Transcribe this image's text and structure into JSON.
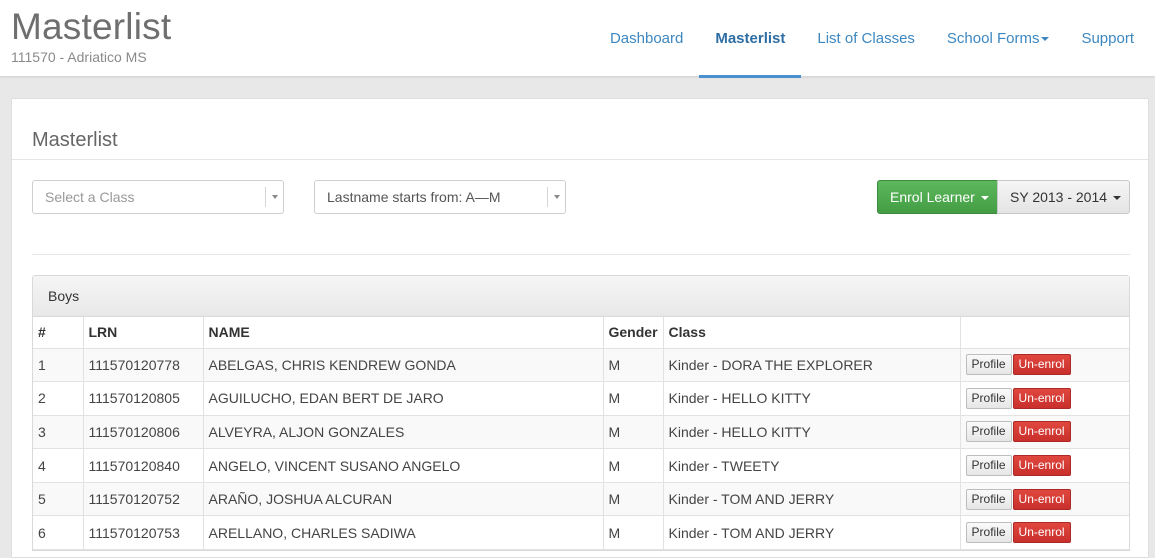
{
  "header": {
    "title": "Masterlist",
    "subtitle": "111570 - Adriatico MS"
  },
  "nav": {
    "items": [
      {
        "label": "Dashboard"
      },
      {
        "label": "Masterlist"
      },
      {
        "label": "List of Classes"
      },
      {
        "label": "School Forms"
      },
      {
        "label": "Support"
      }
    ]
  },
  "panel": {
    "title": "Masterlist"
  },
  "filters": {
    "class_placeholder": "Select a Class",
    "lastname_value": "Lastname starts from: A—M"
  },
  "actions": {
    "enrol_label": "Enrol Learner",
    "school_year_label": "SY 2013 - 2014"
  },
  "group": {
    "title": "Boys",
    "columns": [
      "#",
      "LRN",
      "NAME",
      "Gender",
      "Class",
      ""
    ],
    "profile_label": "Profile",
    "unenrol_label": "Un-enrol",
    "rows": [
      {
        "num": "1",
        "lrn": "111570120778",
        "name": "ABELGAS, CHRIS KENDREW GONDA",
        "gender": "M",
        "class": "Kinder - DORA THE EXPLORER"
      },
      {
        "num": "2",
        "lrn": "111570120805",
        "name": "AGUILUCHO, EDAN BERT DE JARO",
        "gender": "M",
        "class": "Kinder - HELLO KITTY"
      },
      {
        "num": "3",
        "lrn": "111570120806",
        "name": "ALVEYRA, ALJON GONZALES",
        "gender": "M",
        "class": "Kinder - HELLO KITTY"
      },
      {
        "num": "4",
        "lrn": "111570120840",
        "name": "ANGELO, VINCENT SUSANO ANGELO",
        "gender": "M",
        "class": "Kinder - TWEETY"
      },
      {
        "num": "5",
        "lrn": "111570120752",
        "name": "ARAÑO, JOSHUA ALCURAN",
        "gender": "M",
        "class": "Kinder - TOM AND JERRY"
      },
      {
        "num": "6",
        "lrn": "111570120753",
        "name": "ARELLANO, CHARLES SADIWA",
        "gender": "M",
        "class": "Kinder - TOM AND JERRY"
      }
    ]
  }
}
